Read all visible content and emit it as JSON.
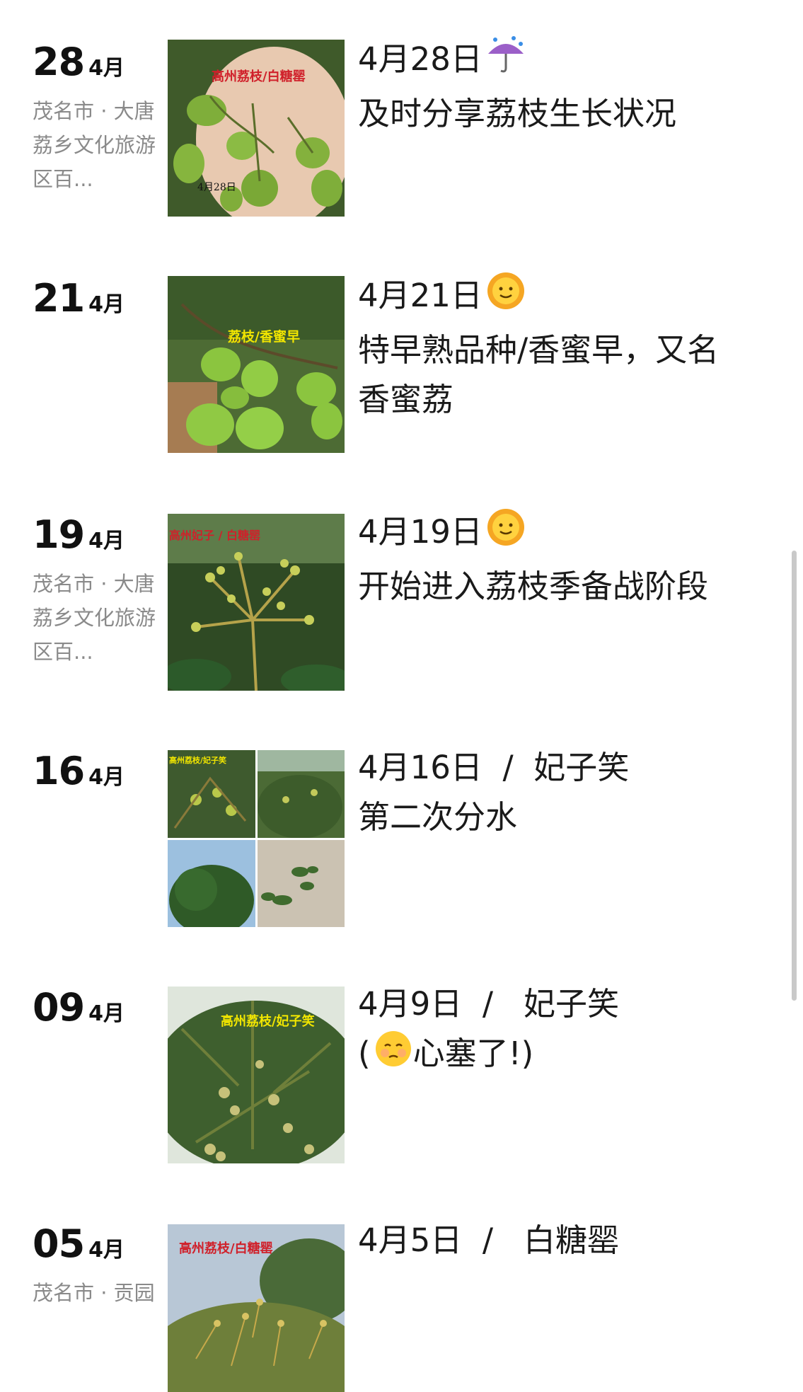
{
  "posts": [
    {
      "day": "28",
      "month": "4月",
      "location": "茂名市 · 大唐荔乡文化旅游区百...",
      "image_caption": "高州荔枝/白糖罂",
      "image_date": "4月28日",
      "line1": "4月28日",
      "emoji": "umbrella-rain-icon",
      "line2": "及时分享荔枝生长状况"
    },
    {
      "day": "21",
      "month": "4月",
      "location": "",
      "image_caption": "荔枝/香蜜早",
      "line1": "4月21日",
      "emoji": "sun-face-icon",
      "line2": "特早熟品种/香蜜早，又名",
      "line3": "香蜜荔"
    },
    {
      "day": "19",
      "month": "4月",
      "location": "茂名市 · 大唐荔乡文化旅游区百...",
      "image_caption": "高州妃子 / 白糖罂",
      "line1": "4月19日",
      "emoji": "sun-face-icon",
      "line2": "开始进入荔枝季备战阶段"
    },
    {
      "day": "16",
      "month": "4月",
      "location": "",
      "image_caption": "高州荔枝/妃子笑",
      "line1": "4月16日  /  妃子笑",
      "line2": "第二次分水"
    },
    {
      "day": "09",
      "month": "4月",
      "location": "",
      "image_caption": "高州荔枝/妃子笑",
      "line1": "4月9日  /   妃子笑",
      "line2_prefix": "(",
      "emoji": "relieved-face-icon",
      "line2_suffix": "心塞了!)"
    },
    {
      "day": "05",
      "month": "4月",
      "location": "茂名市 · 贡园",
      "image_caption": "高州荔枝/白糖罂",
      "line1": "4月5日  /   白糖罂"
    }
  ],
  "colors": {
    "text": "#1a1a1a",
    "location": "#8a8a8a",
    "caption_red": "#d0202a",
    "caption_yellow": "#f2e600",
    "scrollbar": "#c9c9c9"
  }
}
